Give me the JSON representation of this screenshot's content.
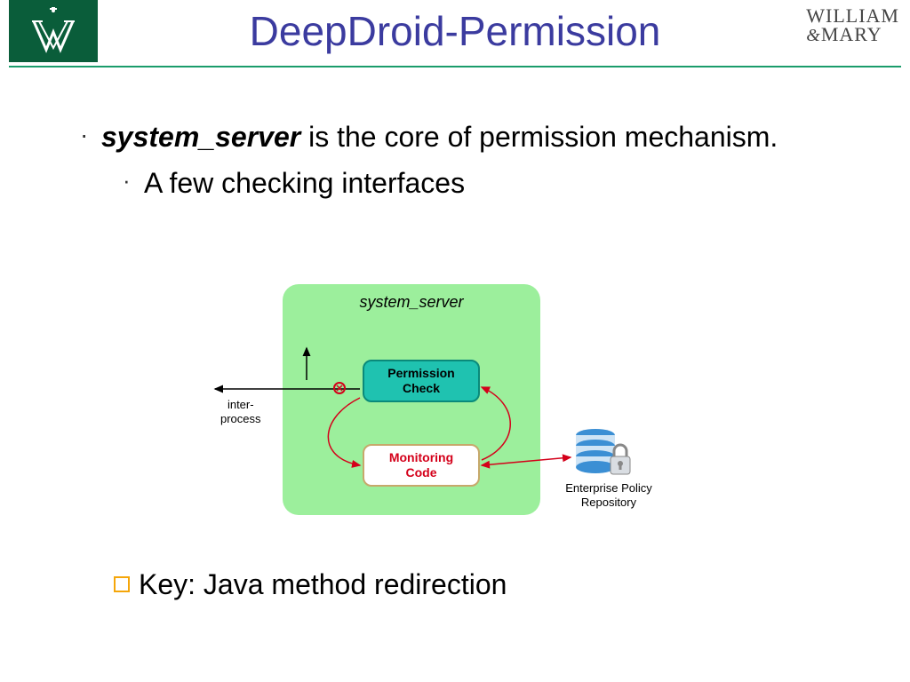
{
  "title": "DeepDroid-Permission",
  "logo_right": {
    "line1": "WILLIAM",
    "amp": "&",
    "line2": "MARY"
  },
  "bullets": {
    "b1_bold": "system_server",
    "b1_rest": " is the core of permission mechanism.",
    "b2": "A few checking interfaces"
  },
  "diagram": {
    "box_label": "system_server",
    "perm_l1": "Permission",
    "perm_l2": "Check",
    "mon_l1": "Monitoring",
    "mon_l2": "Code",
    "inter_l1": "inter-",
    "inter_l2": "process",
    "repo_l1": "Enterprise Policy",
    "repo_l2": "Repository",
    "stop_glyph": "✕"
  },
  "key": {
    "label": "Key: Java method redirection"
  }
}
